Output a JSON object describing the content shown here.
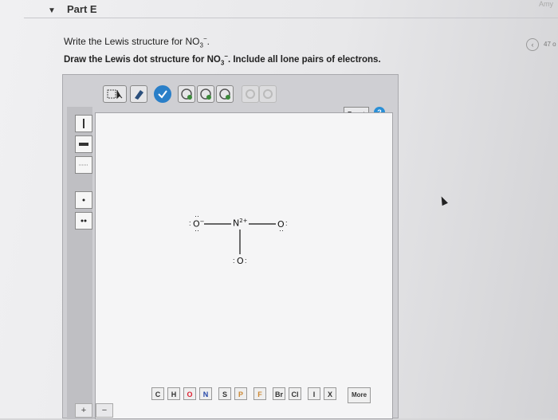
{
  "header": {
    "part_title": "Part E",
    "user_label": "Amy",
    "nav_count": "47 o"
  },
  "question": {
    "prompt_prefix": "Write the Lewis structure for ",
    "prompt_suffix": ".",
    "instruction_prefix": "Draw the Lewis dot structure for ",
    "instruction_suffix": ". Include all lone pairs of electrons.",
    "formula_base": "NO",
    "formula_sub": "3",
    "formula_sup": "−"
  },
  "toolbar": {
    "tools": [
      "select-tool-icon",
      "eraser-icon",
      "check-icon",
      "template-icon-1",
      "template-icon-2",
      "template-icon-3",
      "undo-icon",
      "redo-icon"
    ],
    "reset_label": "Reset",
    "help_label": "?"
  },
  "side_tools": [
    "single-bond-icon",
    "double-bond-icon",
    "triple-bond-icon",
    "lone-pair-icon",
    "radical-icon"
  ],
  "molecule": {
    "central_atom": "N",
    "central_charge": "2+",
    "left_atom": "O",
    "right_atom": "O",
    "bottom_atom": "O",
    "left_charge": "−"
  },
  "element_buttons": [
    "C",
    "H",
    "O",
    "N",
    "S",
    "P",
    "F",
    "Br",
    "Cl",
    "I",
    "X"
  ],
  "more_label": "More",
  "zoom": {
    "plus": "+",
    "minus": "−"
  },
  "colors": {
    "canvas_bg": "#f5f5f6",
    "help_blue": "#2a8fd6",
    "check_blue": "#2a7fc8"
  }
}
